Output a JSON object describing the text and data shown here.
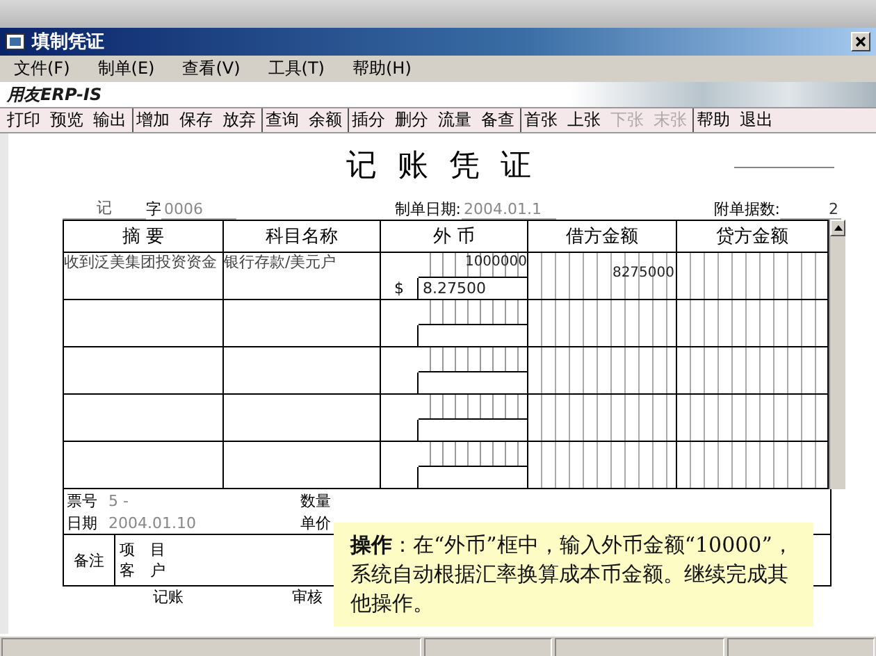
{
  "window": {
    "title": "填制凭证"
  },
  "menu": [
    {
      "label": "文件(F)"
    },
    {
      "label": "制单(E)"
    },
    {
      "label": "查看(V)"
    },
    {
      "label": "工具(T)"
    },
    {
      "label": "帮助(H)"
    }
  ],
  "logo": "用友ERP-IS",
  "toolbar": [
    [
      {
        "label": "打印",
        "disabled": false
      },
      {
        "label": "预览",
        "disabled": false
      },
      {
        "label": "输出",
        "disabled": false
      }
    ],
    [
      {
        "label": "增加",
        "disabled": false
      },
      {
        "label": "保存",
        "disabled": false
      },
      {
        "label": "放弃",
        "disabled": false
      }
    ],
    [
      {
        "label": "查询",
        "disabled": false
      },
      {
        "label": "余额",
        "disabled": false
      }
    ],
    [
      {
        "label": "插分",
        "disabled": false
      },
      {
        "label": "删分",
        "disabled": false
      },
      {
        "label": "流量",
        "disabled": false
      },
      {
        "label": "备查",
        "disabled": false
      }
    ],
    [
      {
        "label": "首张",
        "disabled": false
      },
      {
        "label": "上张",
        "disabled": false
      },
      {
        "label": "下张",
        "disabled": true
      },
      {
        "label": "末张",
        "disabled": true
      }
    ],
    [
      {
        "label": "帮助",
        "disabled": false
      },
      {
        "label": "退出",
        "disabled": false
      }
    ]
  ],
  "voucher": {
    "title": "记 账 凭 证",
    "type": "记",
    "type_suffix": "字",
    "number": "0006",
    "date_label": "制单日期:",
    "date": "2004.01.1",
    "attachments_label": "附单据数:",
    "attachments": "2",
    "columns": [
      "摘 要",
      "科目名称",
      "外 币",
      "借方金额",
      "贷方金额"
    ],
    "rows": [
      {
        "summary": "收到泛美集团投资资金",
        "account": "银行存款/美元户",
        "fc_amount": "1000000",
        "fc_symbol": "$",
        "fc_rate": "8.27500",
        "debit": "8275000"
      }
    ],
    "footer": {
      "ticket_label": "票号",
      "ticket": "5  -",
      "date_label": "日期",
      "date": "2004.01.10",
      "qty_label": "数量",
      "price_label": "单价",
      "note_label": "备注",
      "project_label": "项　目",
      "customer_label": "客　户",
      "bookkeeper_label": "记账",
      "reviewer_label": "审核"
    }
  },
  "tooltip": "**操作**：在“外币”框中，输入外币金额“10000”，系统自动根据汇率换算成本币金额。继续完成其他操作。"
}
